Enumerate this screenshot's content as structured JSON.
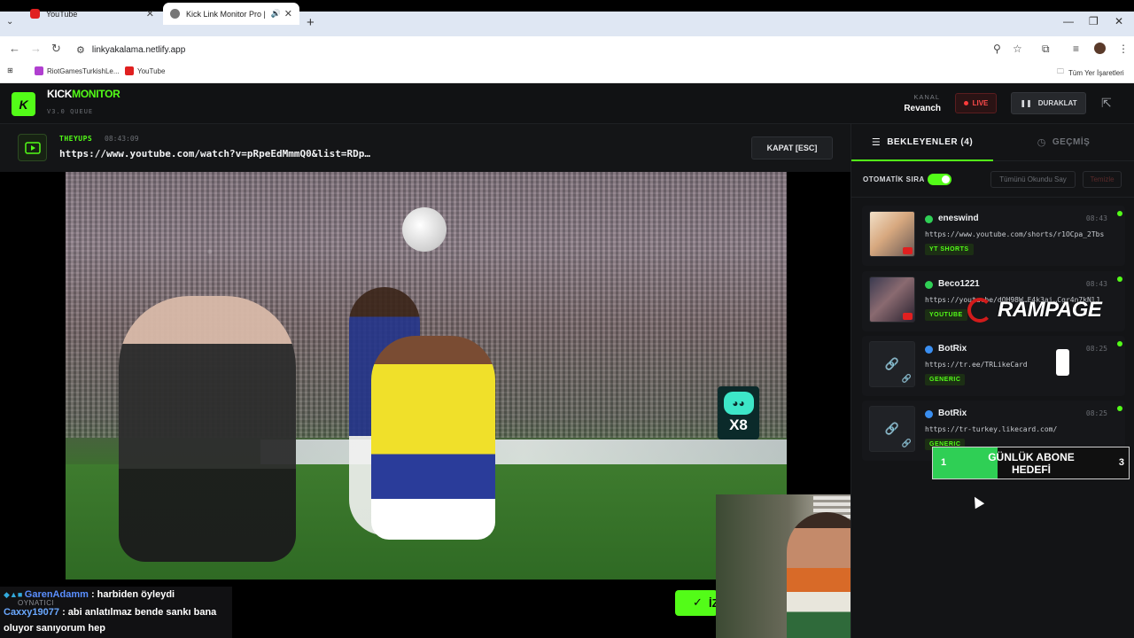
{
  "browser": {
    "tabs": [
      {
        "title": "YouTube",
        "active": false,
        "favicon_color": "#e02020"
      },
      {
        "title": "Kick Link Monitor Pro | Strea",
        "active": true,
        "favicon_color": "#555555"
      }
    ],
    "url": "linkyakalama.netlify.app",
    "bookmarks": [
      {
        "label": "RiotGamesTurkishLe...",
        "color": "#b03fd0"
      },
      {
        "label": "YouTube",
        "color": "#e02020"
      }
    ],
    "all_bookmarks": "Tüm Yer İşaretleri"
  },
  "app": {
    "logo_letter": "K",
    "title_a": "KICK",
    "title_b": "MONITOR",
    "version": "V3.0 QUEUE",
    "channel_label": "KANAL",
    "channel_name": "Revanch",
    "live_label": "LIVE",
    "pause_label": "DURAKLAT",
    "accent": "#53fc18"
  },
  "now_playing": {
    "user": "THEYUPS",
    "time": "08:43:09",
    "url": "https://www.youtube.com/watch?v=pRpeEdMmmQ0&list=RDp…",
    "close_label": "KAPAT [ESC]"
  },
  "sidebar": {
    "tab_waiting": "BEKLEYENLER (4)",
    "tab_history": "GEÇMİŞ",
    "auto_queue_label": "OTOMATİK SIRA",
    "auto_queue_on": true,
    "mark_all_read": "Tümünü Okundu Say",
    "clear_label": "Temizle",
    "queue": [
      {
        "user": "eneswind",
        "time": "08:43",
        "url": "https://www.youtube.com/shorts/r1OCpa_2Tbs",
        "tag": "YT SHORTS",
        "dot": "#2fcf55",
        "thumb": "img1"
      },
      {
        "user": "Beco1221",
        "time": "08:43",
        "url": "https://youtu.be/dOH98W…E4k3ai…Cgr4n7kNlJ",
        "tag": "YOUTUBE",
        "dot": "#2fcf55",
        "thumb": "img2"
      },
      {
        "user": "BotRix",
        "time": "08:25",
        "url": "https://tr.ee/TRLikeCard",
        "tag": "GENERIC",
        "dot": "#3a8ef0",
        "thumb": "link"
      },
      {
        "user": "BotRix",
        "time": "08:25",
        "url": "https://tr-turkey.likecard.com/",
        "tag": "GENERIC",
        "dot": "#3a8ef0",
        "thumb": "link"
      }
    ]
  },
  "overlays": {
    "chat": [
      {
        "user": "GarenAdamm",
        "msg": " : harbiden öyleydi"
      },
      {
        "user": "Caxxy19077",
        "msg": " : abi anlatılmaz bende sankı bana"
      },
      {
        "user": "",
        "msg": "oluyor sanıyorum hep"
      }
    ],
    "player_label": "OYNATICI",
    "watch_button_partial": "İZ",
    "emote_count": "X8",
    "rampage_text": "RAMPAGE",
    "goal_title": "GÜNLÜK ABONE HEDEFİ",
    "goal_current": "1",
    "goal_target": "3",
    "goal_progress": 0.33
  }
}
